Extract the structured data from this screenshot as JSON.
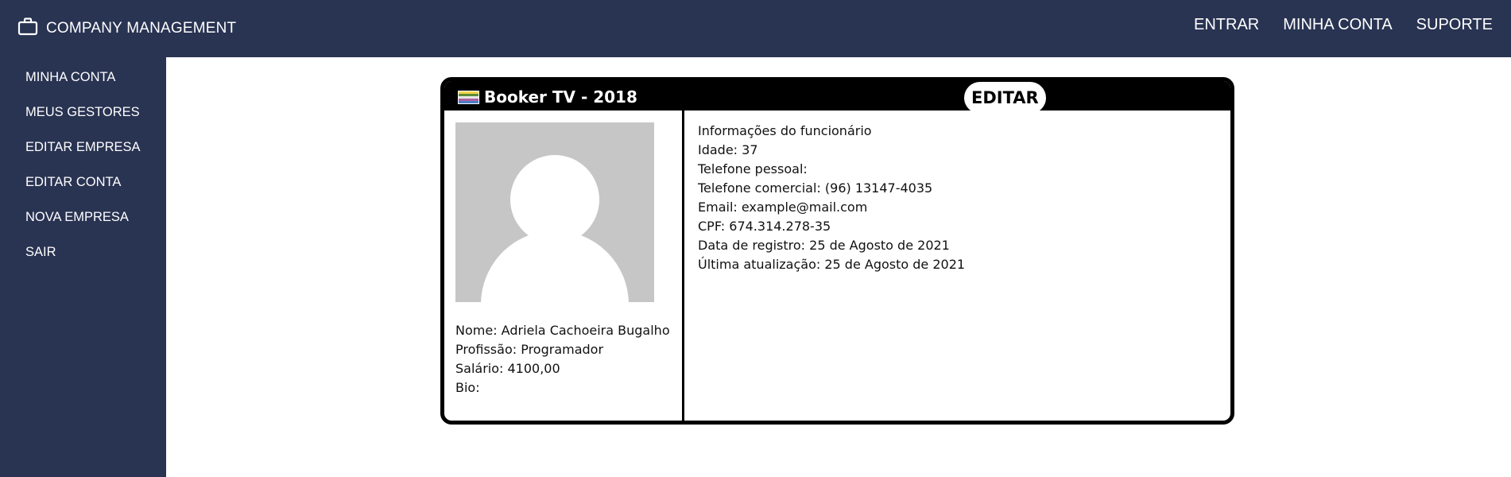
{
  "app": {
    "title": "COMPANY MANAGEMENT",
    "icon": "briefcase-icon"
  },
  "topnav": {
    "items": [
      {
        "label": "ENTRAR"
      },
      {
        "label": "MINHA CONTA"
      },
      {
        "label": "SUPORTE"
      }
    ]
  },
  "sidebar": {
    "items": [
      {
        "label": "MINHA CONTA"
      },
      {
        "label": "MEUS GESTORES"
      },
      {
        "label": "EDITAR EMPRESA"
      },
      {
        "label": "EDITAR CONTA"
      },
      {
        "label": "NOVA EMPRESA"
      },
      {
        "label": "SAIR"
      }
    ]
  },
  "card": {
    "title": "Booker TV - 2018",
    "flag_icon": "flag-icon",
    "edit_label": "EDITAR",
    "left": {
      "nome": "Nome: Adriela Cachoeira Bugalho",
      "profissao": "Profissão: Programador",
      "salario": "Salário: 4100,00",
      "bio": "Bio:"
    },
    "right": {
      "heading": "Informações do funcionário",
      "idade": "Idade: 37",
      "telefone_pessoal": "Telefone pessoal:",
      "telefone_comercial": "Telefone comercial: (96) 13147-4035",
      "email": "Email: example@mail.com",
      "cpf": "CPF: 674.314.278-35",
      "data_registro": "Data de registro: 25 de Agosto de 2021",
      "ultima_atualizacao": "Última atualização: 25 de Agosto de 2021"
    }
  },
  "colors": {
    "nav_bg": "#293352",
    "card_border": "#000000",
    "avatar_bg": "#c6c6c6"
  }
}
